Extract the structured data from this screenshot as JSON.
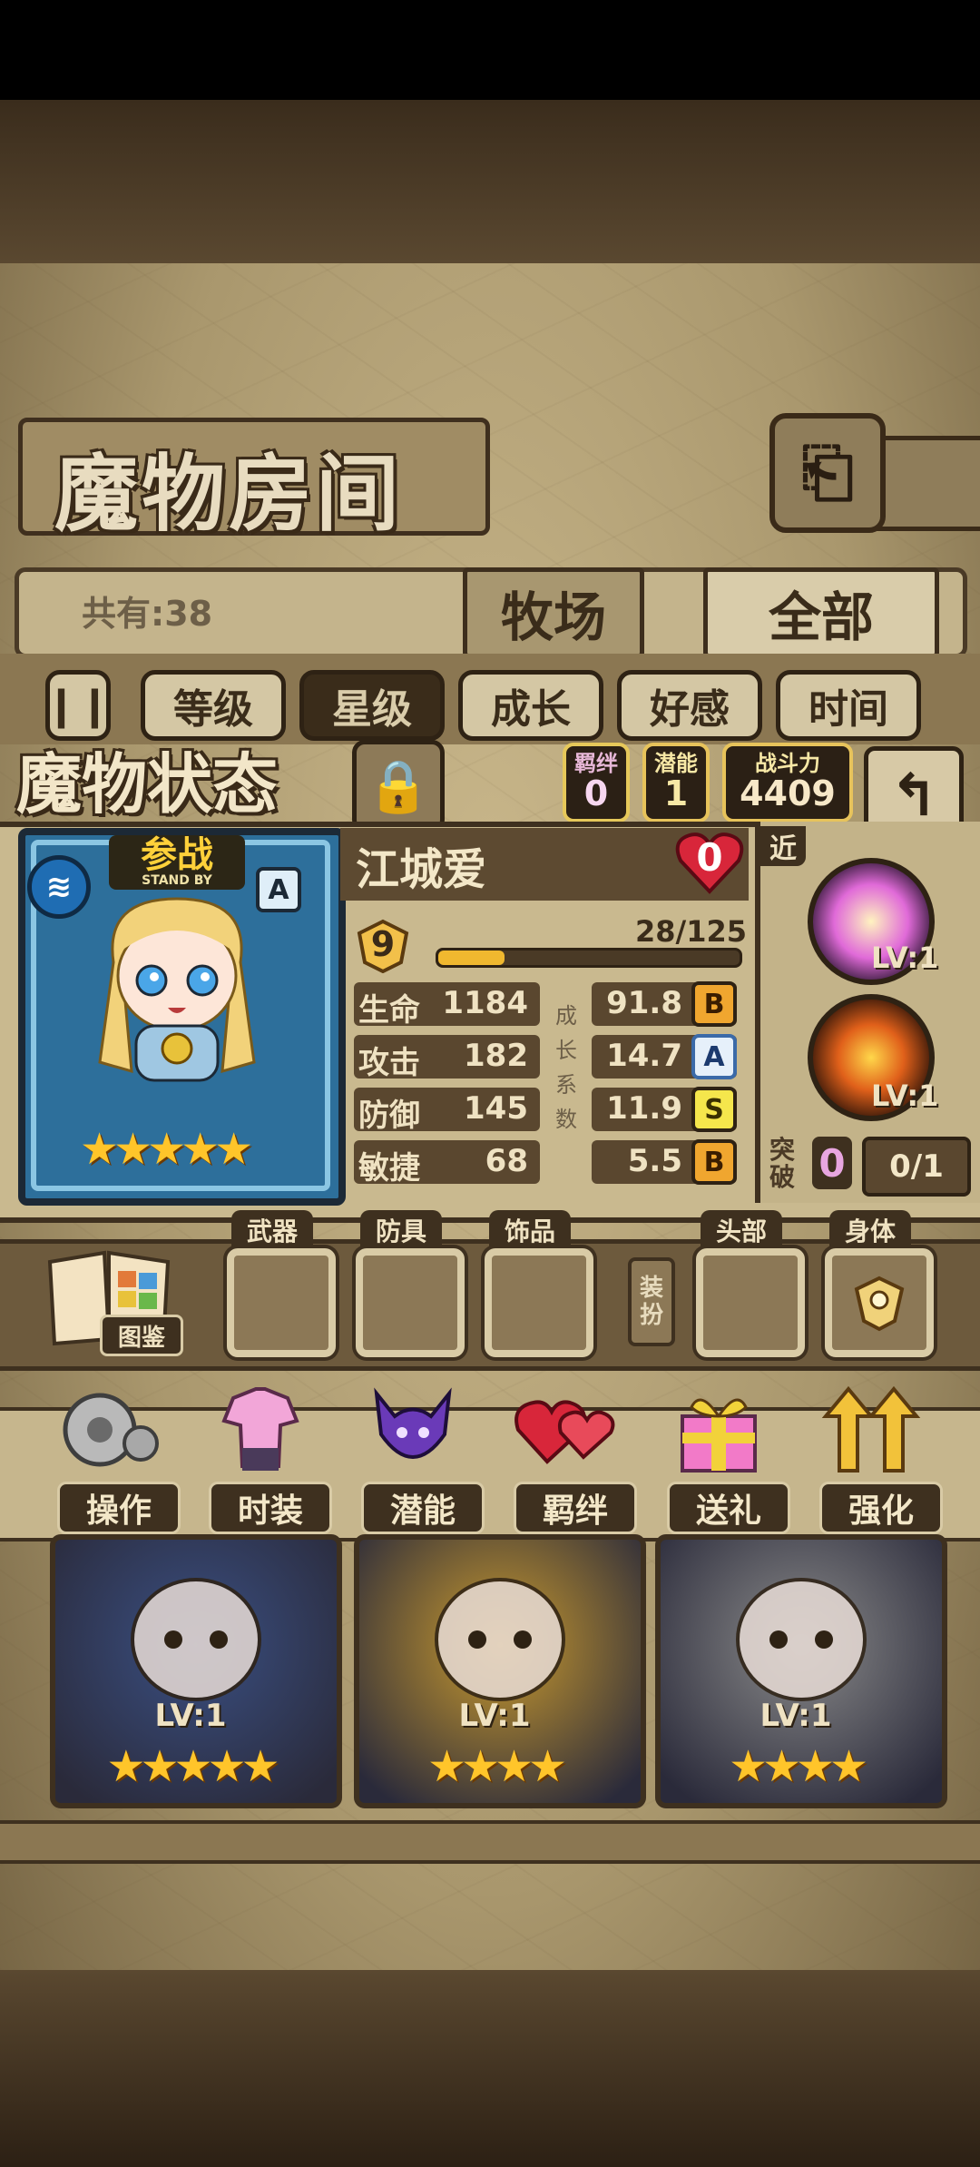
{
  "header": {
    "title": "魔物房间",
    "back_icon": "back-arrow-icon"
  },
  "collection": {
    "count_label": "共有:38"
  },
  "tabs": [
    {
      "label": "牧场",
      "active": false
    },
    {
      "label": "全部",
      "active": true
    }
  ],
  "sort": {
    "toggle_icon": "pause-icon",
    "options": [
      {
        "label": "等级",
        "active": false
      },
      {
        "label": "星级",
        "active": true
      },
      {
        "label": "成长",
        "active": false
      },
      {
        "label": "好感",
        "active": false
      },
      {
        "label": "时间",
        "active": false
      }
    ]
  },
  "status": {
    "title": "魔物状态",
    "bond_label": "羁绊",
    "bond_value": "0",
    "potential_label": "潜能",
    "potential_value": "1",
    "power_label": "战斗力",
    "power_value": "4409"
  },
  "monster": {
    "name": "江城爱",
    "affection": "0",
    "standby_label": "参战",
    "standby_sub": "STAND BY",
    "rank": "A",
    "stars": 5,
    "level": "9",
    "exp_text": "28/125",
    "exp_fraction": 0.224,
    "stats": [
      {
        "label": "生命",
        "value": "1184",
        "growth": "91.8",
        "grade": "B"
      },
      {
        "label": "攻击",
        "value": "182",
        "growth": "14.7",
        "grade": "A"
      },
      {
        "label": "防御",
        "value": "145",
        "growth": "11.9",
        "grade": "S"
      },
      {
        "label": "敏捷",
        "value": "68",
        "growth": "5.5",
        "grade": "B"
      }
    ],
    "growth_vertical": [
      "成",
      "长",
      "系",
      "数"
    ],
    "range": "近",
    "skills": [
      {
        "level": "LV:1",
        "icon": "light-skill-icon"
      },
      {
        "level": "LV:1",
        "icon": "fire-sword-skill-icon"
      }
    ],
    "breakthrough_label": "突破",
    "breakthrough_count": "0",
    "breakthrough_progress": "0/1"
  },
  "equipment": {
    "book_label": "图鉴",
    "slots": [
      {
        "label": "武器"
      },
      {
        "label": "防具"
      },
      {
        "label": "饰品"
      },
      {
        "label": "头部"
      },
      {
        "label": "身体"
      }
    ],
    "dress_label": "装扮"
  },
  "actions": [
    {
      "label": "操作",
      "icon": "gear-icon"
    },
    {
      "label": "时装",
      "icon": "outfit-icon"
    },
    {
      "label": "潜能",
      "icon": "demon-icon"
    },
    {
      "label": "羁绊",
      "icon": "hearts-icon"
    },
    {
      "label": "送礼",
      "icon": "gift-icon"
    },
    {
      "label": "强化",
      "icon": "upgrade-arrows-icon"
    }
  ],
  "monster_list": [
    {
      "level": "LV:1",
      "stars": 5,
      "color": "#3a4f82"
    },
    {
      "level": "LV:1",
      "stars": 4,
      "color": "#c99a2f"
    },
    {
      "level": "LV:1",
      "stars": 4,
      "color": "#8a8a8a"
    }
  ]
}
